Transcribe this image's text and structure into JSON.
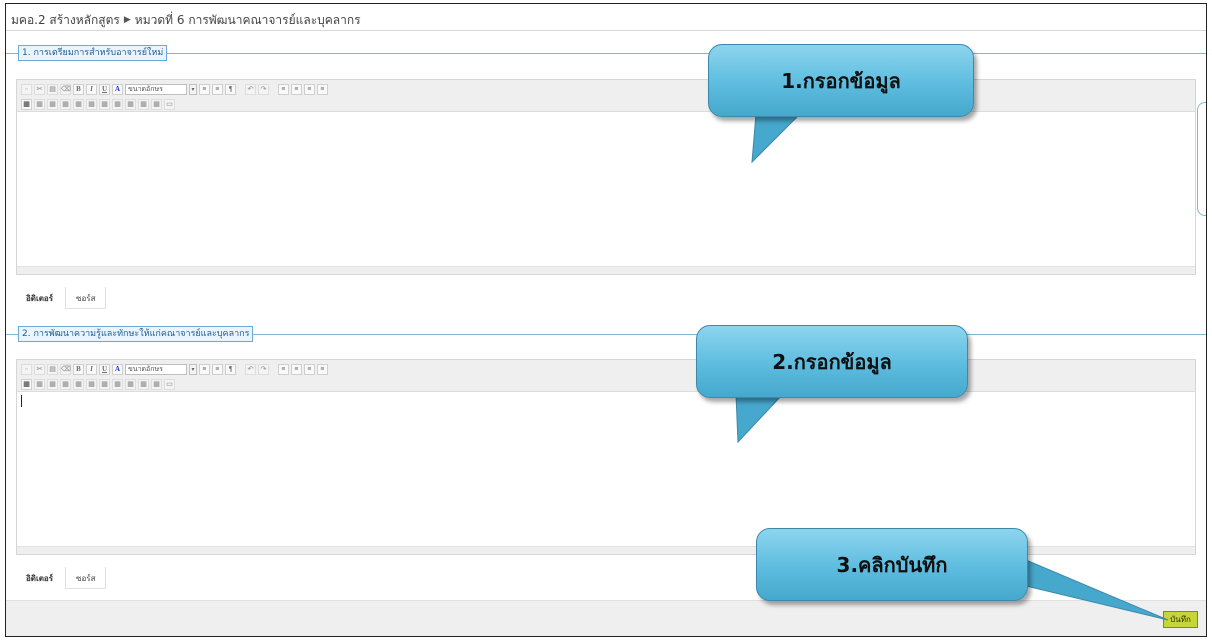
{
  "breadcrumb": {
    "item1": "มคอ.2 สร้างหลักสูตร",
    "separator": "▶",
    "item2": "หมวดที่ 6 การพัฒนาคณาจารย์และบุคลากร"
  },
  "sections": [
    {
      "legend": "1. การเตรียมการสำหรับอาจารย์ใหม่",
      "content": ""
    },
    {
      "legend": "2. การพัฒนาความรู้และทักษะให้แก่คณาจารย์และบุคลากร",
      "content": ""
    }
  ],
  "editor": {
    "font_size_placeholder": "ขนาดอักษร",
    "tab_editor": "อิดิเตอร์",
    "tab_source": "ซอร์ส"
  },
  "save_label": "บันทึก",
  "callouts": {
    "c1": "1.กรอกข้อมูล",
    "c2": "2.กรอกข้อมูล",
    "c3": "3.คลิกบันทึก"
  },
  "colors": {
    "callout": "#5dbcdf",
    "save_button": "#c6d636",
    "legend_border": "#6aa9d8"
  }
}
